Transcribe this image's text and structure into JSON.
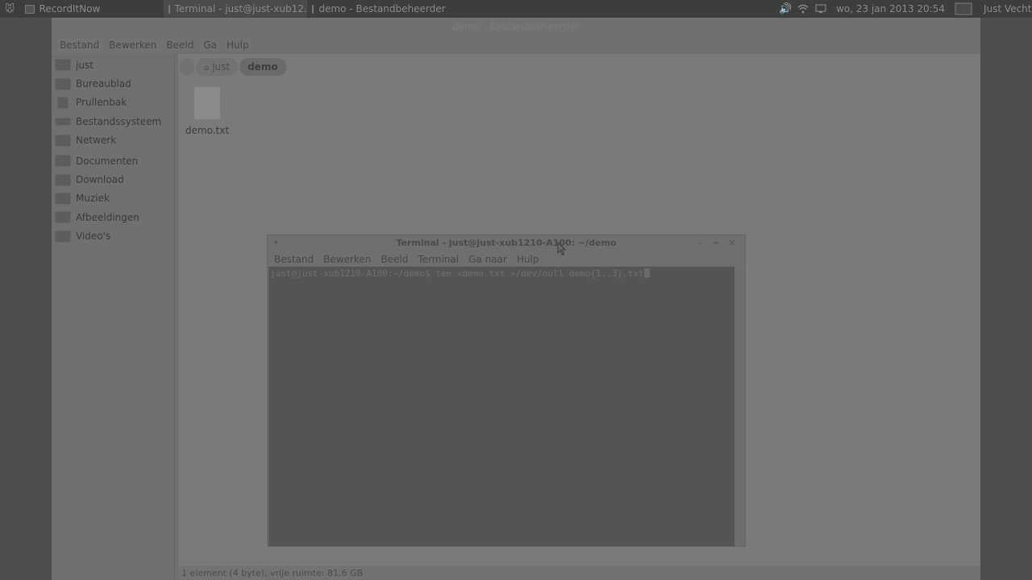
{
  "panel": {
    "app_menu_icon": "mouse-logo-icon",
    "recorder_label": "RecordItNow",
    "task_terminal": "Terminal - just@just-xub12...",
    "task_filemanager": "demo - Bestandbeheerder",
    "datetime": "wo, 23 jan 2013 20:54",
    "user": "Just Vecht"
  },
  "filemanager": {
    "title": "demo - Bestandbeheerder",
    "menu": [
      "Bestand",
      "Bewerken",
      "Beeld",
      "Ga",
      "Hulp"
    ],
    "sidebar": [
      {
        "label": "just",
        "icon": "home-folder-icon"
      },
      {
        "label": "Bureaublad",
        "icon": "desktop-icon"
      },
      {
        "label": "Prullenbak",
        "icon": "trash-icon"
      },
      {
        "label": "Bestandssysteem",
        "icon": "drive-icon"
      },
      {
        "label": "Netwerk",
        "icon": "network-icon"
      },
      {
        "label": "Documenten",
        "icon": "folder-icon"
      },
      {
        "label": "Download",
        "icon": "folder-icon"
      },
      {
        "label": "Muziek",
        "icon": "folder-icon"
      },
      {
        "label": "Afbeeldingen",
        "icon": "folder-icon"
      },
      {
        "label": "Video's",
        "icon": "folder-icon"
      }
    ],
    "breadcrumbs": [
      "just",
      "demo"
    ],
    "files": [
      {
        "name": "demo.txt",
        "icon": "text-file-icon"
      }
    ],
    "status": "1 element (4 byte), vrije ruimte: 81,6 GB"
  },
  "terminal": {
    "title": "Terminal - just@just-xub1210-A100: ~/demo",
    "menu": [
      "Bestand",
      "Bewerken",
      "Beeld",
      "Terminal",
      "Ga naar",
      "Hulp"
    ],
    "prompt_line": "just@just-xub1210-A100:~/demo$ tee <demo.txt >/dev/null demo{1..3}.txt"
  }
}
